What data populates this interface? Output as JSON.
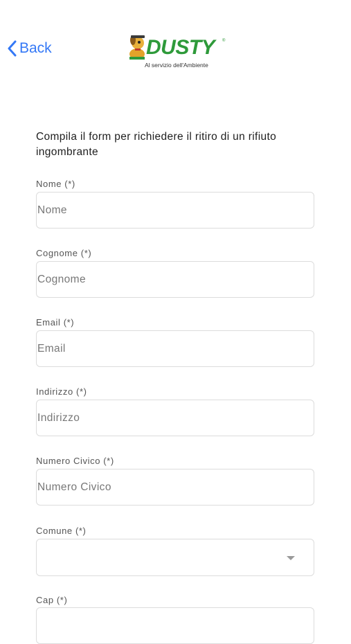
{
  "nav": {
    "back_label": "Back",
    "logo": {
      "wordmark": "DUSTY",
      "tagline": "Al servizio dell'Ambiente",
      "mascot_icon": "dog-mascot-icon",
      "brand_color": "#2e9a3a"
    }
  },
  "form": {
    "intro": "Compila il form per richiedere il ritiro di un rifiuto ingombrante",
    "fields": [
      {
        "label": "Nome (*)",
        "placeholder": "Nome"
      },
      {
        "label": "Cognome (*)",
        "placeholder": "Cognome"
      },
      {
        "label": "Email (*)",
        "placeholder": "Email"
      },
      {
        "label": "Indirizzo (*)",
        "placeholder": "Indirizzo"
      },
      {
        "label": "Numero Civico (*)",
        "placeholder": "Numero Civico"
      },
      {
        "label": "Comune (*)",
        "selected": ""
      },
      {
        "label": "Cap (*)",
        "placeholder": ""
      }
    ]
  },
  "colors": {
    "accent": "#3478f6",
    "border": "#dcdcdc"
  }
}
